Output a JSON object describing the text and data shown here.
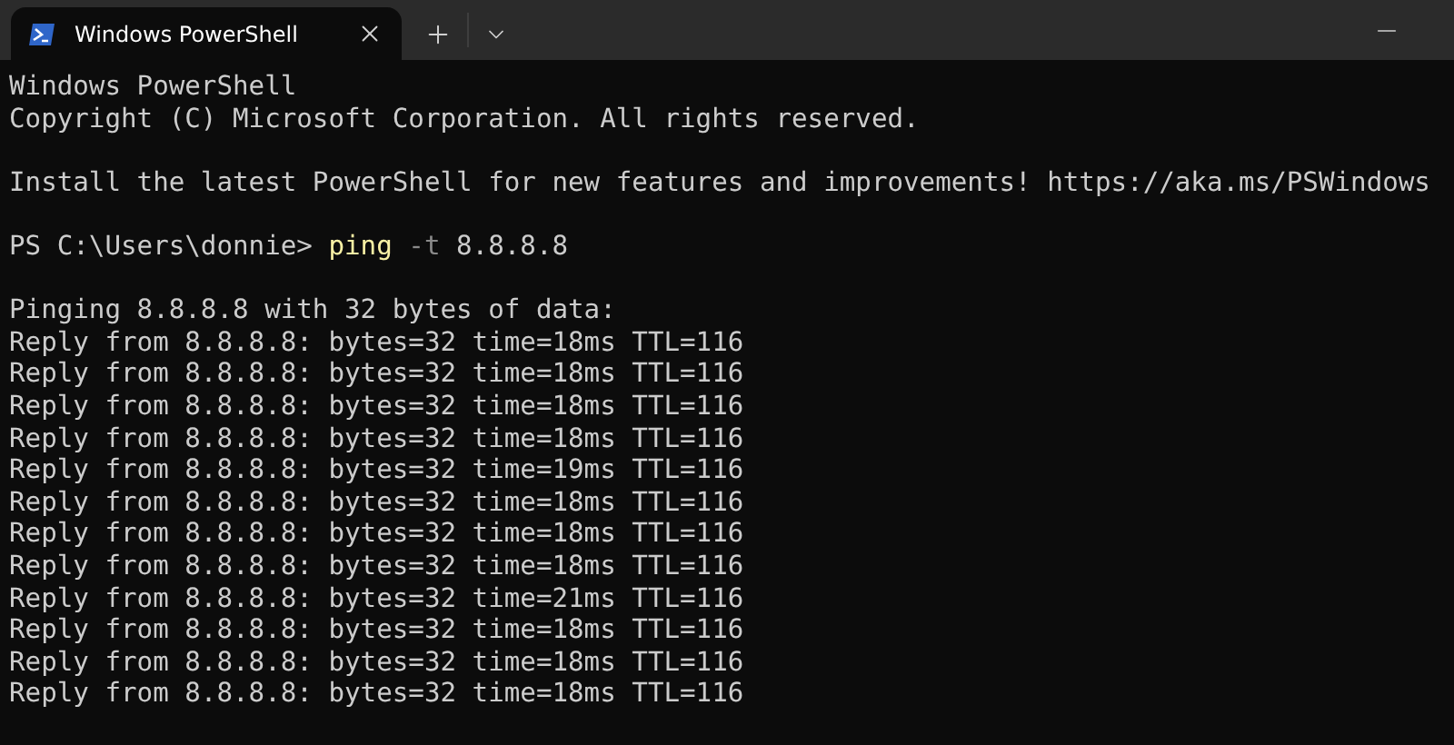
{
  "tabs": [
    {
      "title": "Windows PowerShell",
      "selected": true
    }
  ],
  "terminal": {
    "lines": [
      {
        "kind": "output",
        "text": "Windows PowerShell"
      },
      {
        "kind": "output",
        "text": "Copyright (C) Microsoft Corporation. All rights reserved."
      },
      {
        "kind": "blank"
      },
      {
        "kind": "output",
        "text": "Install the latest PowerShell for new features and improvements! https://aka.ms/PSWindows"
      },
      {
        "kind": "blank"
      },
      {
        "kind": "command",
        "prompt": "PS C:\\Users\\donnie>",
        "command": "ping",
        "parameter": "-t",
        "argument": "8.8.8.8"
      },
      {
        "kind": "blank"
      },
      {
        "kind": "output",
        "text": "Pinging 8.8.8.8 with 32 bytes of data:"
      },
      {
        "kind": "output",
        "text": "Reply from 8.8.8.8: bytes=32 time=18ms TTL=116"
      },
      {
        "kind": "output",
        "text": "Reply from 8.8.8.8: bytes=32 time=18ms TTL=116"
      },
      {
        "kind": "output",
        "text": "Reply from 8.8.8.8: bytes=32 time=18ms TTL=116"
      },
      {
        "kind": "output",
        "text": "Reply from 8.8.8.8: bytes=32 time=18ms TTL=116"
      },
      {
        "kind": "output",
        "text": "Reply from 8.8.8.8: bytes=32 time=19ms TTL=116"
      },
      {
        "kind": "output",
        "text": "Reply from 8.8.8.8: bytes=32 time=18ms TTL=116"
      },
      {
        "kind": "output",
        "text": "Reply from 8.8.8.8: bytes=32 time=18ms TTL=116"
      },
      {
        "kind": "output",
        "text": "Reply from 8.8.8.8: bytes=32 time=18ms TTL=116"
      },
      {
        "kind": "output",
        "text": "Reply from 8.8.8.8: bytes=32 time=21ms TTL=116"
      },
      {
        "kind": "output",
        "text": "Reply from 8.8.8.8: bytes=32 time=18ms TTL=116"
      },
      {
        "kind": "output",
        "text": "Reply from 8.8.8.8: bytes=32 time=18ms TTL=116"
      },
      {
        "kind": "output",
        "text": "Reply from 8.8.8.8: bytes=32 time=18ms TTL=116"
      }
    ]
  }
}
